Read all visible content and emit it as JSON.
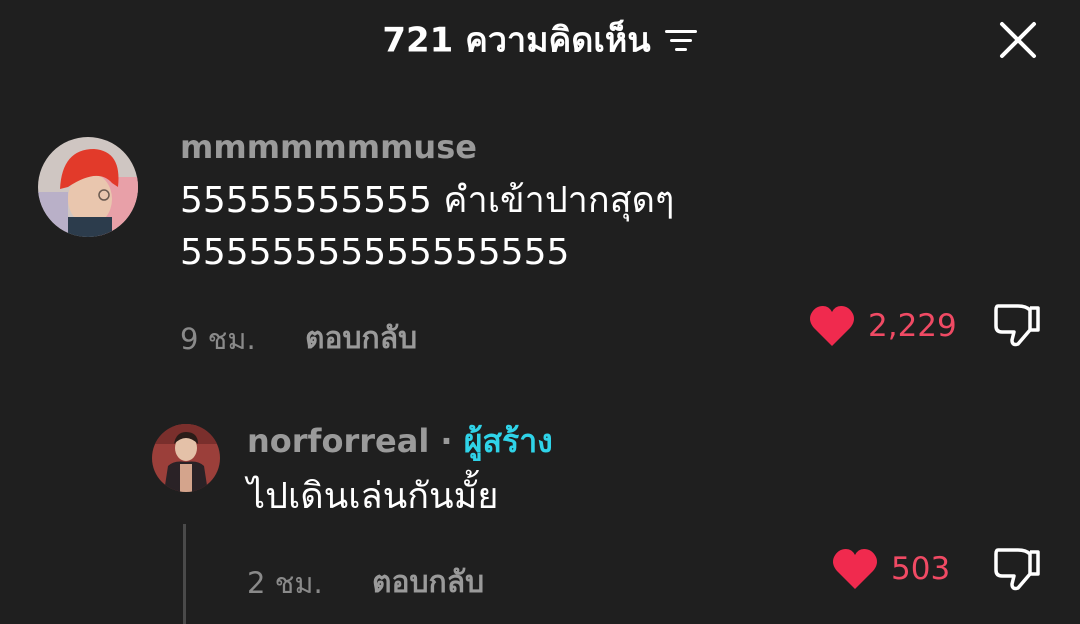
{
  "header": {
    "title": "721 ความคิดเห็น",
    "filter_icon": "filter-icon",
    "close_icon": "close-icon"
  },
  "comments": [
    {
      "username": "mmmmmmmuse",
      "text_line1": "55555555555 คำเข้าปากสุดๆ",
      "text_line2": "55555555555555555",
      "time": "9 ชม.",
      "reply_label": "ตอบกลับ",
      "likes": "2,229"
    }
  ],
  "replies": [
    {
      "username": "norforreal",
      "separator": "·",
      "badge": "ผู้สร้าง",
      "text": "ไปเดินเล่นกันมั้ย",
      "time": "2 ชม.",
      "reply_label": "ตอบกลับ",
      "likes": "503"
    }
  ],
  "colors": {
    "background": "#1f1f1f",
    "like_red": "#f04a64",
    "creator_cyan": "#2fd3e8",
    "muted_text": "#9a9a9a"
  }
}
